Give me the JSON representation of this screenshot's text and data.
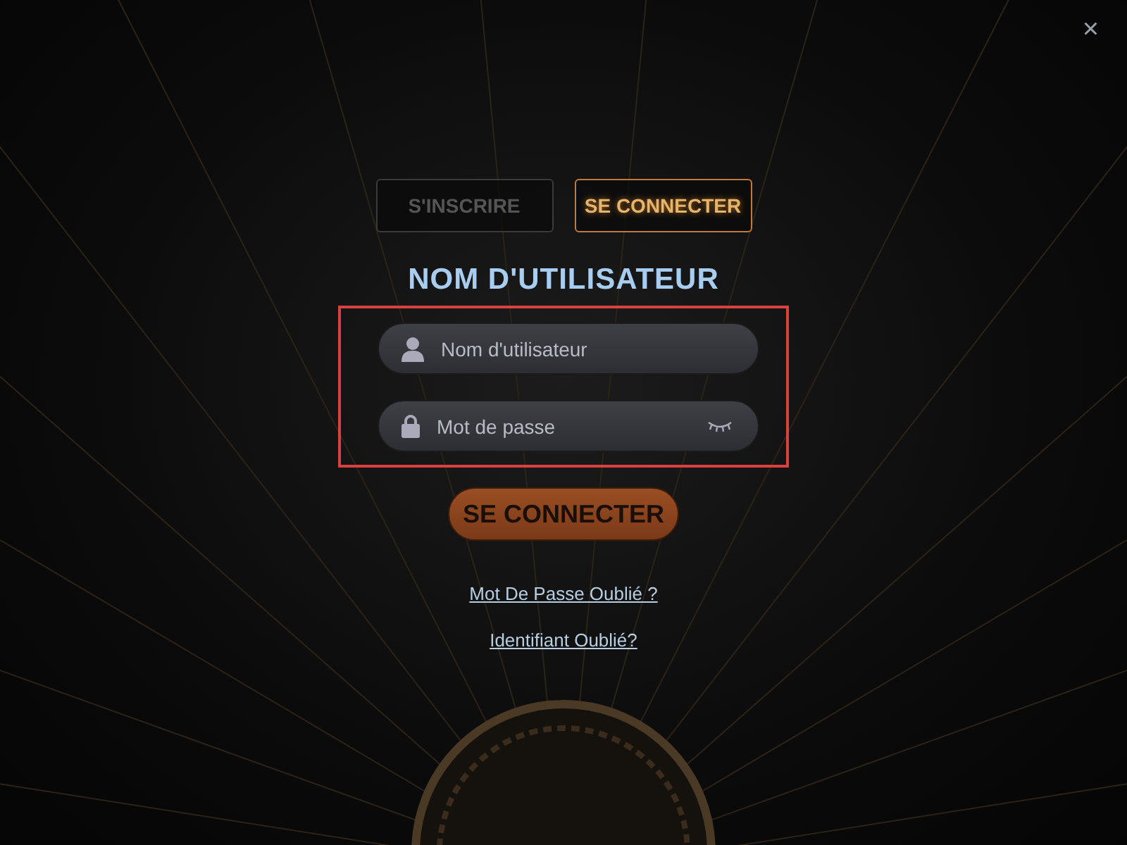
{
  "close_button": "×",
  "tabs": [
    {
      "label": "S'INSCRIRE",
      "selected": false
    },
    {
      "label": "SE CONNECTER",
      "selected": true
    }
  ],
  "heading": "NOM D'UTILISATEUR",
  "fields": [
    {
      "kind": "user",
      "placeholder": "Nom d'utilisateur"
    },
    {
      "kind": "password",
      "placeholder": "Mot de passe"
    }
  ],
  "submit_button": "SE CONNECTER",
  "links": [
    "Mot De Passe Oublié ?",
    "Identifiant Oublié?"
  ]
}
